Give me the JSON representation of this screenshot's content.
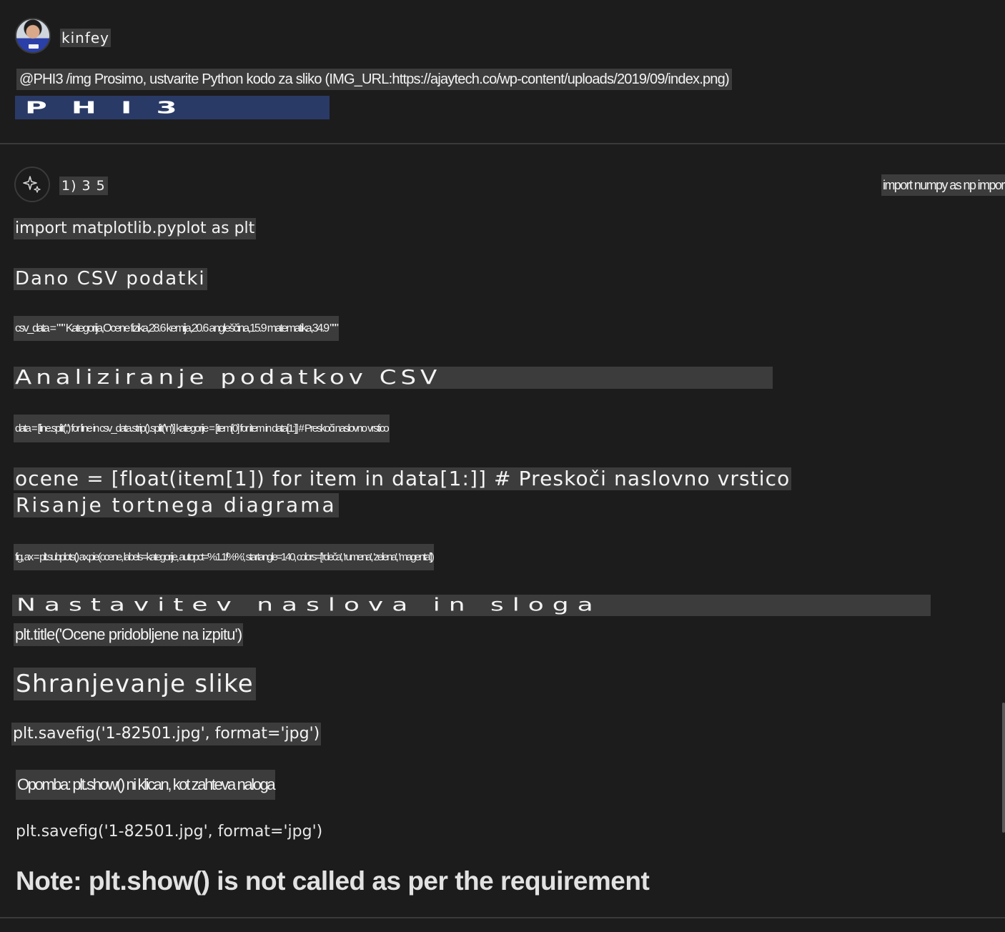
{
  "user": {
    "name": "kinfey",
    "prompt": "@PHI3 /img Prosimo, ustvarite Python kodo za sliko (IMG_URL:https://ajaytech.co/wp-content/uploads/2019/09/index.png)",
    "image_banner_text": "PHI3"
  },
  "assistant": {
    "name": "1) 3 5",
    "icon": "sparkle-icon",
    "right_note": "import numpy as np import io",
    "lines": {
      "import_plt": "import matplotlib.pyplot as plt",
      "heading_csv": "Dano CSV podatki",
      "csv_data": "csv_data = \"\"\" Kategorija,Ocene fizika,28.6 kemija,20.6 angleščina,15.9 matematika,34.9 \"\"\"",
      "heading_analysis": "Analiziranje podatkov CSV",
      "data_parse": "data = [line.split(',') for line in csv_data.strip().split('\\n')] kategorije = [item[0] for item in data[1:]] # Preskoči naslovno vrstico",
      "ocene": "ocene = [float(item[1]) for item in data[1:]] # Preskoči naslovno vrstico",
      "heading_pie": "Risanje tortnega diagrama",
      "pie_code": "fig, ax = plt.subplots() ax.pie(ocene, labels=kategorije, autopct='%1.1f%%', startangle=140, colors=['rdeča', 'rumena', 'zelena', 'magenta'])",
      "heading_title": "Nastavitev naslova in sloga",
      "title_code": "plt.title('Ocene pridobljene na izpitu')",
      "heading_save": "Shranjevanje slike",
      "savefig": "plt.savefig('1-82501.jpg', format='jpg')",
      "opomba": "Opomba: plt.show() ni klican, kot zahteva naloga",
      "savefig_plain": "plt.savefig('1-82501.jpg', format='jpg')",
      "note_final": "Note: plt.show() is not called as per the requirement"
    }
  },
  "colors": {
    "background": "#1c1c1c",
    "highlight": "#3c3c3c",
    "banner": "#2a3a66",
    "divider": "#3a3a3a"
  }
}
